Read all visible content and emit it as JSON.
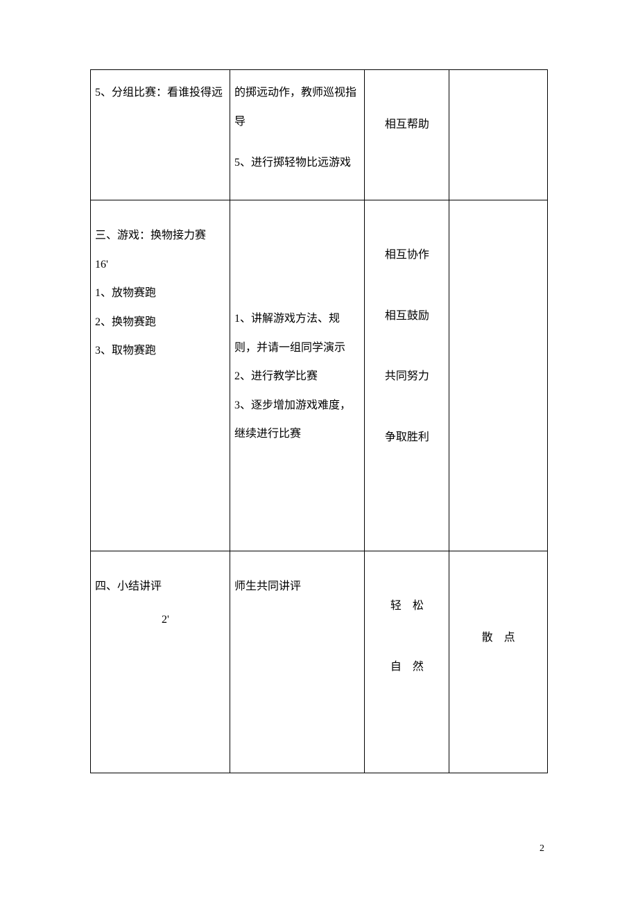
{
  "row1": {
    "c1": {
      "l1": "5、分组比赛：看谁投得远"
    },
    "c2": {
      "l1": "的掷远动作，教师巡视指导",
      "l2": "5、进行掷轻物比远游戏"
    },
    "c3": {
      "l1": "相互帮助"
    }
  },
  "row2": {
    "c1": {
      "l1": "三、游戏：换物接力赛",
      "l2": "16'",
      "l3": "1、放物赛跑",
      "l4": "2、换物赛跑",
      "l5": "3、取物赛跑"
    },
    "c2": {
      "l1": "1、讲解游戏方法、规则，并请一组同学演示",
      "l2": "2、进行教学比赛",
      "l3": "3、逐步增加游戏难度，继续进行比赛"
    },
    "c3": {
      "l1": "相互协作",
      "l2": "相互鼓励",
      "l3": "共同努力",
      "l4": "争取胜利"
    }
  },
  "row3": {
    "c1": {
      "l1": "四、小结讲评",
      "l2": "2'"
    },
    "c2": {
      "l1": "师生共同讲评"
    },
    "c3": {
      "l1": "轻　松",
      "l2": "自　然"
    },
    "c4": {
      "l1": "散　点"
    }
  },
  "pageNumber": "2"
}
